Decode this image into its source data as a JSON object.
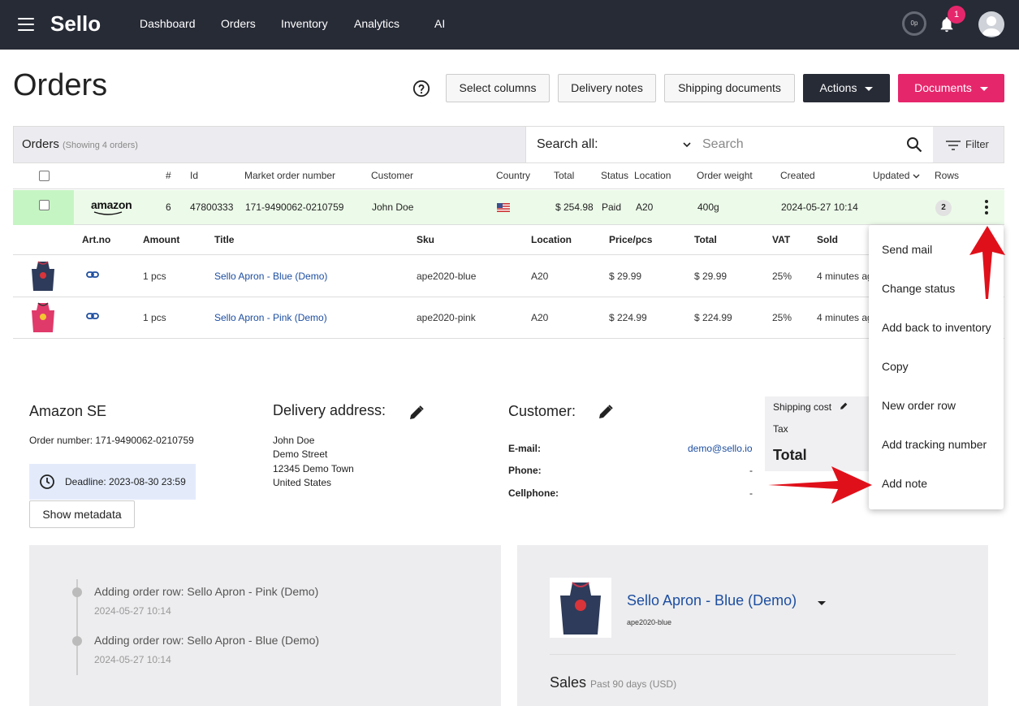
{
  "nav": {
    "logo": "Sello",
    "links": [
      "Dashboard",
      "Orders",
      "Inventory",
      "Analytics",
      "AI"
    ],
    "status_circle": "0p",
    "notifications": "1"
  },
  "header": {
    "title": "Orders",
    "buttons": {
      "select_columns": "Select columns",
      "delivery_notes": "Delivery notes",
      "shipping_documents": "Shipping documents",
      "actions": "Actions",
      "documents": "Documents"
    },
    "colors": {
      "dark": "#272b36",
      "pink": "#e6266b"
    }
  },
  "orders_bar": {
    "label": "Orders",
    "showing": "(Showing 4 orders)",
    "search_scope": "Search all:",
    "search_placeholder": "Search",
    "filter": "Filter"
  },
  "table": {
    "columns": [
      "#",
      "Id",
      "Market order number",
      "Customer",
      "Country",
      "Total",
      "Status",
      "Location",
      "Order weight",
      "Created",
      "Updated",
      "Rows"
    ],
    "order": {
      "market": "amazon",
      "num": "6",
      "id": "47800333",
      "market_order_number": "171-9490062-0210759",
      "customer": "John Doe",
      "country_flag": "us-flag",
      "total": "$ 254.98",
      "status": "Paid",
      "location": "A20",
      "weight": "400g",
      "created": "2024-05-27 10:14",
      "rows": "2"
    }
  },
  "items": {
    "columns": [
      "Art.no",
      "Amount",
      "Title",
      "Sku",
      "Location",
      "Price/pcs",
      "Total",
      "VAT",
      "Sold"
    ],
    "rows": [
      {
        "amount": "1 pcs",
        "title": "Sello Apron - Blue (Demo)",
        "sku": "ape2020-blue",
        "location": "A20",
        "price": "$ 29.99",
        "total": "$ 29.99",
        "vat": "25%",
        "sold": "4 minutes ag"
      },
      {
        "amount": "1 pcs",
        "title": "Sello Apron - Pink (Demo)",
        "sku": "ape2020-pink",
        "location": "A20",
        "price": "$ 224.99",
        "total": "$ 224.99",
        "vat": "25%",
        "sold": "4 minutes ag"
      }
    ]
  },
  "details": {
    "market": {
      "title": "Amazon SE",
      "order_number": "Order number: 171-9490062-0210759",
      "deadline": "Deadline: 2023-08-30 23:59",
      "show_metadata": "Show metadata"
    },
    "delivery": {
      "title": "Delivery address:",
      "lines": [
        "John Doe",
        "Demo Street",
        "12345 Demo Town",
        "United States"
      ]
    },
    "customer": {
      "title": "Customer:",
      "email_label": "E-mail:",
      "email": "demo@sello.io",
      "phone_label": "Phone:",
      "phone": "-",
      "cellphone_label": "Cellphone:",
      "cellphone": "-"
    },
    "shipping": {
      "shipping_cost": "Shipping cost",
      "tax": "Tax",
      "total": "Total"
    }
  },
  "menu": {
    "items": [
      "Send mail",
      "Change status",
      "Add back to inventory",
      "Copy",
      "New order row",
      "Add tracking number",
      "Add note"
    ]
  },
  "timeline": [
    {
      "title": "Adding order row: Sello Apron - Pink (Demo)",
      "date": "2024-05-27 10:14"
    },
    {
      "title": "Adding order row: Sello Apron - Blue (Demo)",
      "date": "2024-05-27 10:14"
    }
  ],
  "product": {
    "title": "Sello Apron - Blue (Demo)",
    "sku": "ape2020-blue",
    "sales_title": "Sales",
    "sales_sub": "Past 90 days (USD)"
  },
  "annotation_color": "#e0101a"
}
